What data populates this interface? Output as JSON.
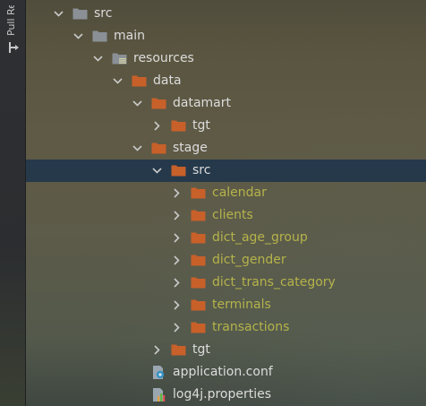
{
  "side_panel": {
    "label": "Pull Re"
  },
  "tree": {
    "items": [
      {
        "label": "src",
        "depth": 0,
        "icon": "folder-gray",
        "expanded": true,
        "selected": false,
        "excluded": false
      },
      {
        "label": "main",
        "depth": 1,
        "icon": "folder-gray",
        "expanded": true,
        "selected": false,
        "excluded": false
      },
      {
        "label": "resources",
        "depth": 2,
        "icon": "folder-resources",
        "expanded": true,
        "selected": false,
        "excluded": false
      },
      {
        "label": "data",
        "depth": 3,
        "icon": "folder-orange",
        "expanded": true,
        "selected": false,
        "excluded": false
      },
      {
        "label": "datamart",
        "depth": 4,
        "icon": "folder-orange",
        "expanded": true,
        "selected": false,
        "excluded": false
      },
      {
        "label": "tgt",
        "depth": 5,
        "icon": "folder-orange",
        "expanded": false,
        "selected": false,
        "excluded": false
      },
      {
        "label": "stage",
        "depth": 4,
        "icon": "folder-orange",
        "expanded": true,
        "selected": false,
        "excluded": false
      },
      {
        "label": "src",
        "depth": 5,
        "icon": "folder-orange",
        "expanded": true,
        "selected": true,
        "excluded": false
      },
      {
        "label": "calendar",
        "depth": 6,
        "icon": "folder-orange",
        "expanded": false,
        "selected": false,
        "excluded": true
      },
      {
        "label": "clients",
        "depth": 6,
        "icon": "folder-orange",
        "expanded": false,
        "selected": false,
        "excluded": true
      },
      {
        "label": "dict_age_group",
        "depth": 6,
        "icon": "folder-orange",
        "expanded": false,
        "selected": false,
        "excluded": true
      },
      {
        "label": "dict_gender",
        "depth": 6,
        "icon": "folder-orange",
        "expanded": false,
        "selected": false,
        "excluded": true
      },
      {
        "label": "dict_trans_category",
        "depth": 6,
        "icon": "folder-orange",
        "expanded": false,
        "selected": false,
        "excluded": true
      },
      {
        "label": "terminals",
        "depth": 6,
        "icon": "folder-orange",
        "expanded": false,
        "selected": false,
        "excluded": true
      },
      {
        "label": "transactions",
        "depth": 6,
        "icon": "folder-orange",
        "expanded": false,
        "selected": false,
        "excluded": true
      },
      {
        "label": "tgt",
        "depth": 5,
        "icon": "folder-orange",
        "expanded": false,
        "selected": false,
        "excluded": false
      },
      {
        "label": "application.conf",
        "depth": 4,
        "icon": "config-file",
        "expanded": null,
        "selected": false,
        "excluded": false
      },
      {
        "label": "log4j.properties",
        "depth": 4,
        "icon": "properties-file",
        "expanded": null,
        "selected": false,
        "excluded": false
      }
    ]
  },
  "colors": {
    "folder_orange": "#c8602a",
    "folder_gray": "#8a9096",
    "excluded_text": "#b5b34a",
    "normal_text": "#dcdcdc",
    "selection": "#25394b"
  }
}
